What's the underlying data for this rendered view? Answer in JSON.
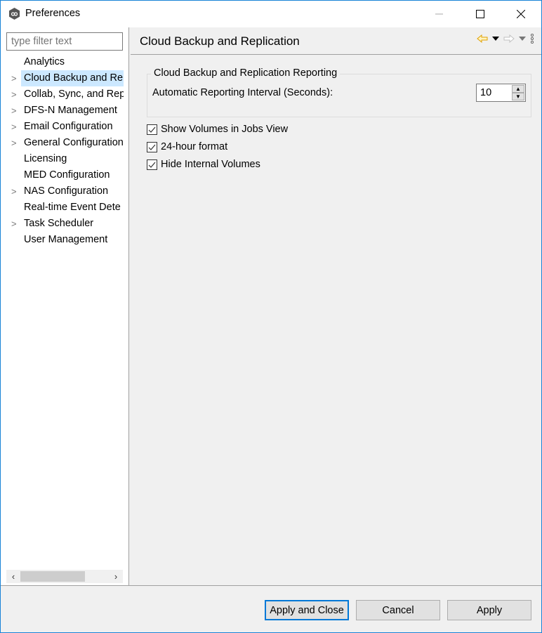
{
  "window": {
    "title": "Preferences",
    "icon": "app-logo-icon"
  },
  "filter": {
    "placeholder": "type filter text"
  },
  "tree": [
    {
      "label": "Analytics",
      "expandable": false,
      "selected": false
    },
    {
      "label": "Cloud Backup and Re",
      "expandable": true,
      "selected": true
    },
    {
      "label": "Collab, Sync, and Rep",
      "expandable": true,
      "selected": false
    },
    {
      "label": "DFS-N Management",
      "expandable": true,
      "selected": false
    },
    {
      "label": "Email Configuration",
      "expandable": true,
      "selected": false
    },
    {
      "label": "General Configuration",
      "expandable": true,
      "selected": false
    },
    {
      "label": "Licensing",
      "expandable": false,
      "selected": false
    },
    {
      "label": "MED Configuration",
      "expandable": false,
      "selected": false
    },
    {
      "label": "NAS Configuration",
      "expandable": true,
      "selected": false
    },
    {
      "label": "Real-time Event Dete",
      "expandable": false,
      "selected": false
    },
    {
      "label": "Task Scheduler",
      "expandable": true,
      "selected": false
    },
    {
      "label": "User Management",
      "expandable": false,
      "selected": false
    }
  ],
  "page": {
    "title": "Cloud Backup and Replication",
    "group_title": "Cloud Backup and Replication Reporting",
    "interval_label": "Automatic Reporting Interval (Seconds):",
    "interval_value": "10",
    "checkboxes": [
      {
        "label": "Show Volumes in Jobs View",
        "checked": true
      },
      {
        "label": "24-hour format",
        "checked": true
      },
      {
        "label": "Hide Internal Volumes",
        "checked": true
      }
    ]
  },
  "buttons": {
    "apply_close": "Apply and Close",
    "cancel": "Cancel",
    "apply": "Apply"
  },
  "colors": {
    "accent": "#0078d7",
    "selection": "#cce8ff",
    "back_arrow": "#e0a000"
  }
}
